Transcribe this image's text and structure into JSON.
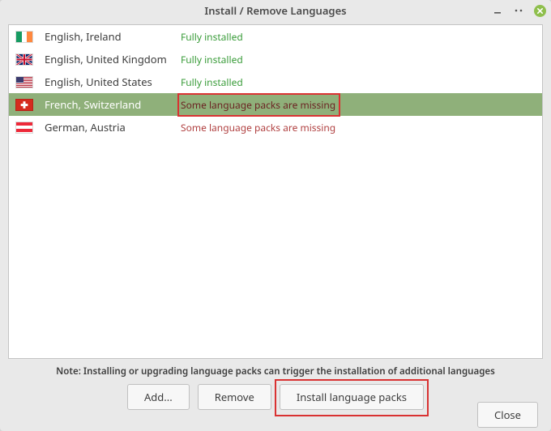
{
  "window": {
    "title": "Install / Remove Languages"
  },
  "languages": [
    {
      "name": "English, Ireland",
      "status": "Fully installed",
      "status_kind": "installed",
      "flag": "ie",
      "selected": false
    },
    {
      "name": "English, United Kingdom",
      "status": "Fully installed",
      "status_kind": "installed",
      "flag": "uk",
      "selected": false
    },
    {
      "name": "English, United States",
      "status": "Fully installed",
      "status_kind": "installed",
      "flag": "us",
      "selected": false
    },
    {
      "name": "French, Switzerland",
      "status": "Some language packs are missing",
      "status_kind": "missing",
      "flag": "ch",
      "selected": true
    },
    {
      "name": "German, Austria",
      "status": "Some language packs are missing",
      "status_kind": "missing",
      "flag": "at",
      "selected": false
    }
  ],
  "note": "Note: Installing or upgrading language packs can trigger the installation of additional languages",
  "buttons": {
    "add": "Add...",
    "remove": "Remove",
    "install": "Install language packs",
    "close": "Close"
  },
  "colors": {
    "selection": "#8fb07a",
    "status_installed": "#3a9c3a",
    "status_missing": "#b04040",
    "highlight_border": "#d93232"
  }
}
